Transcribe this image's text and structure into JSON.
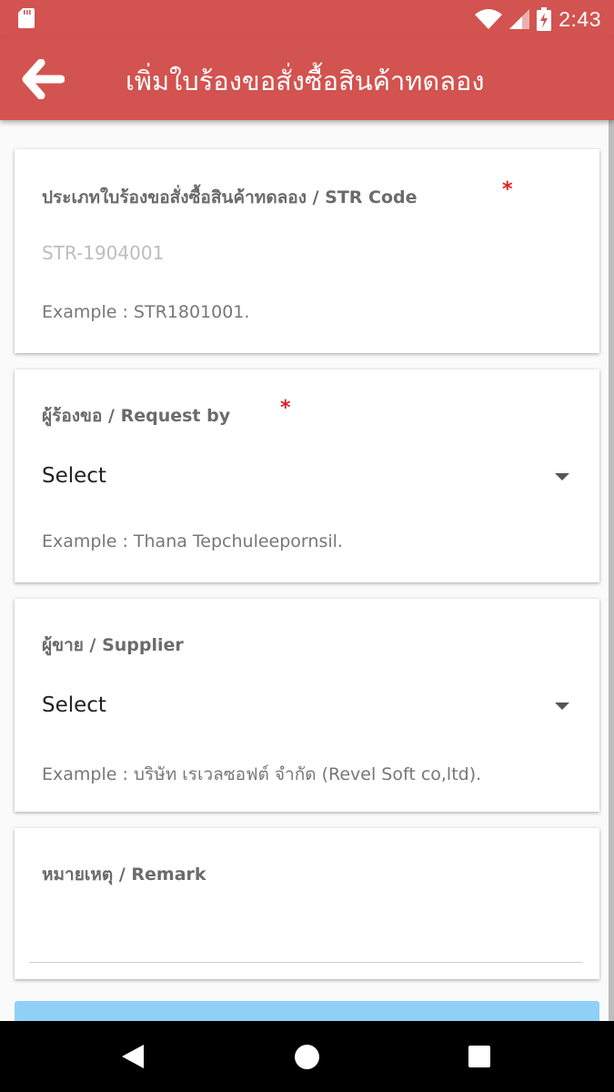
{
  "status_bar": {
    "time": "2:43",
    "icons": [
      "sd-card-icon",
      "wifi-icon",
      "signal-icon",
      "battery-charging-icon"
    ]
  },
  "app_bar": {
    "title": "เพิ่มใบร้องขอสั่งซื้อสินค้าทดลอง",
    "back_icon": "arrow-back-icon"
  },
  "form": {
    "str_code": {
      "label": "ประเภทใบร้องขอสั่งซื้อสินค้าทดลอง / STR Code",
      "required_mark": "*",
      "value": "STR-1904001",
      "example": "Example : STR1801001."
    },
    "request_by": {
      "label": "ผู้ร้องขอ / Request by",
      "required_mark": "*",
      "selected": "Select",
      "example": "Example : Thana Tepchuleepornsil."
    },
    "supplier": {
      "label": "ผู้ขาย / Supplier",
      "selected": "Select",
      "example": "Example : บริษัท เรเวลซอฟต์ จำกัด (Revel Soft co,ltd)."
    },
    "remark": {
      "label": "หมายเหตุ / Remark",
      "value": ""
    }
  },
  "colors": {
    "primary": "#d2534f",
    "required": "#e02020",
    "submit_button": "#8fd0f7",
    "nav_bar": "#000000"
  },
  "nav_bar": {
    "icons": [
      "nav-back-icon",
      "nav-home-icon",
      "nav-recents-icon"
    ]
  }
}
